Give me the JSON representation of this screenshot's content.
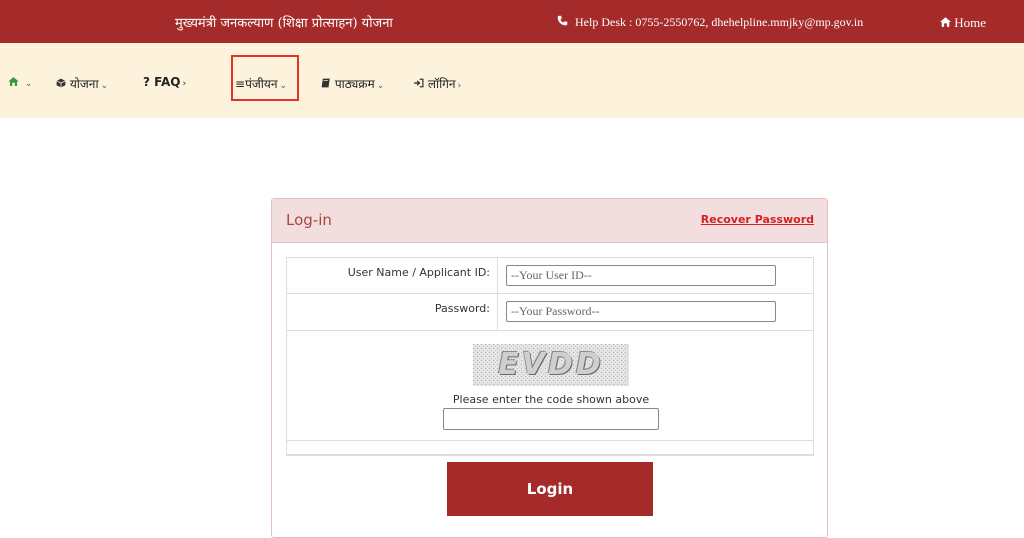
{
  "topbar": {
    "title": "मुख्यमंत्री जनकल्याण (शिक्षा प्रोत्साहन) योजना",
    "phone_icon": "phone-icon",
    "helpdesk": "Help Desk : 0755-2550762, dhehelpline.mmjky@mp.gov.in",
    "home_icon": "home-icon",
    "home_label": "Home"
  },
  "nav": {
    "home_icon": "home-icon",
    "items": [
      {
        "icon": "cube-icon",
        "label": "योजना"
      },
      {
        "icon": "question-icon",
        "label": "FAQ"
      },
      {
        "icon": "list-icon",
        "label": "पंजीयन"
      },
      {
        "icon": "book-icon",
        "label": "पाठ्यक्रम"
      },
      {
        "icon": "sign-in-icon",
        "label": "लॉगिन"
      }
    ],
    "highlight_color": "#e4322b"
  },
  "login_panel": {
    "title": "Log-in",
    "recover_link": "Recover Password",
    "username_label": "User Name / Applicant ID:",
    "username_placeholder": "--Your User ID--",
    "password_label": "Password:",
    "password_placeholder": "--Your Password--",
    "captcha_text": "EVDD",
    "captcha_caption": "Please enter the code shown above",
    "captcha_value": "",
    "login_button": "Login"
  },
  "colors": {
    "brand": "#a52a2a",
    "nav_bg": "#fdf2dc",
    "panel_head_bg": "#f2dede",
    "panel_title": "#a94442",
    "link": "#d61f1f"
  }
}
